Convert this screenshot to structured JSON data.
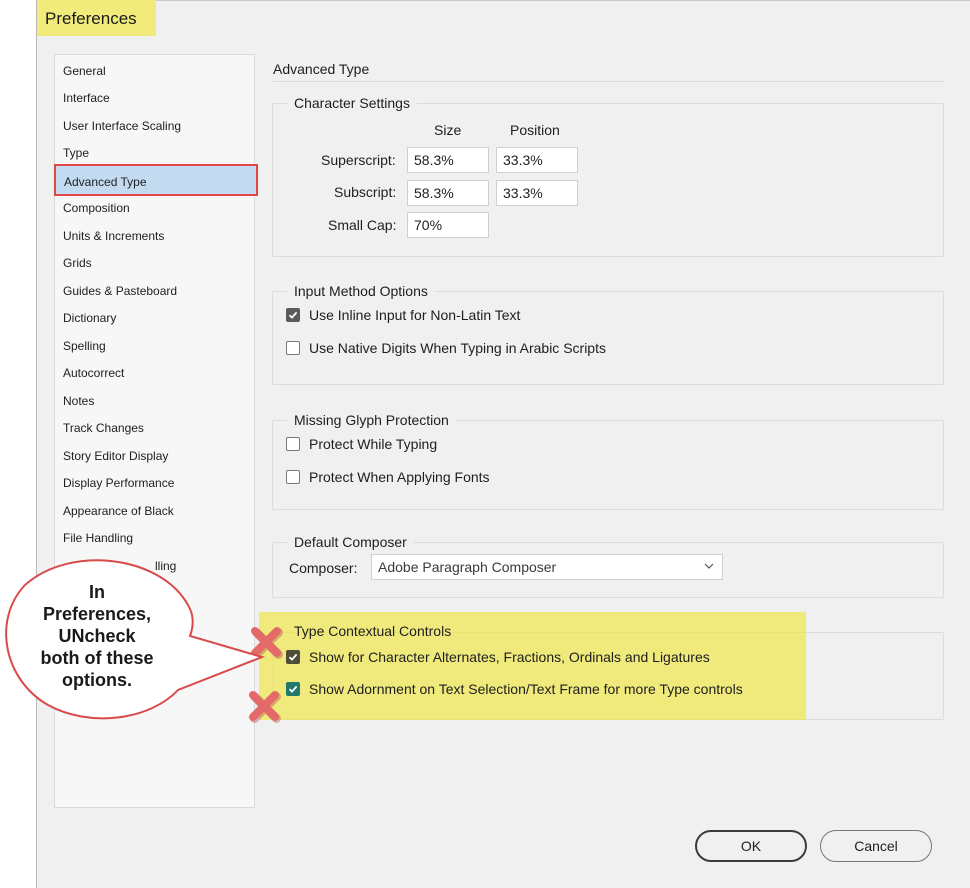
{
  "window": {
    "title": "Preferences"
  },
  "nav": {
    "items": [
      "General",
      "Interface",
      "User Interface Scaling",
      "Type",
      "Advanced Type",
      "Composition",
      "Units & Increments",
      "Grids",
      "Guides & Pasteboard",
      "Dictionary",
      "Spelling",
      "Autocorrect",
      "Notes",
      "Track Changes",
      "Story Editor Display",
      "Display Performance",
      "Appearance of Black",
      "File Handling",
      "Clipboard Handling"
    ],
    "partial_item_text": "lling",
    "selected": "Advanced Type"
  },
  "panel": {
    "title": "Advanced Type",
    "character_settings": {
      "legend": "Character Settings",
      "col_size": "Size",
      "col_position": "Position",
      "superscript_label": "Superscript:",
      "superscript_size": "58.3%",
      "superscript_position": "33.3%",
      "subscript_label": "Subscript:",
      "subscript_size": "58.3%",
      "subscript_position": "33.3%",
      "smallcap_label": "Small Cap:",
      "smallcap_value": "70%"
    },
    "input_method": {
      "legend": "Input Method Options",
      "inline_input": "Use Inline Input for Non-Latin Text",
      "native_digits": "Use Native Digits When Typing in Arabic Scripts"
    },
    "missing_glyph": {
      "legend": "Missing Glyph Protection",
      "while_typing": "Protect While Typing",
      "applying_fonts": "Protect When Applying Fonts"
    },
    "composer": {
      "legend": "Default Composer",
      "label": "Composer:",
      "value": "Adobe Paragraph Composer"
    },
    "contextual": {
      "legend": "Type Contextual Controls",
      "alternates": "Show for Character Alternates, Fractions, Ordinals and Ligatures",
      "adornment": "Show Adornment on Text Selection/Text Frame for more Type controls"
    }
  },
  "buttons": {
    "ok": "OK",
    "cancel": "Cancel"
  },
  "annotation": {
    "line1": "In",
    "line2": "Preferences,",
    "line3": "UNcheck",
    "line4": "both of these",
    "line5": "options."
  },
  "colors": {
    "highlight_yellow": "#f0e850",
    "selection_blue": "#c3dbf1",
    "annotation_red": "#e04848",
    "checkbox_green": "#1f7a6c"
  }
}
